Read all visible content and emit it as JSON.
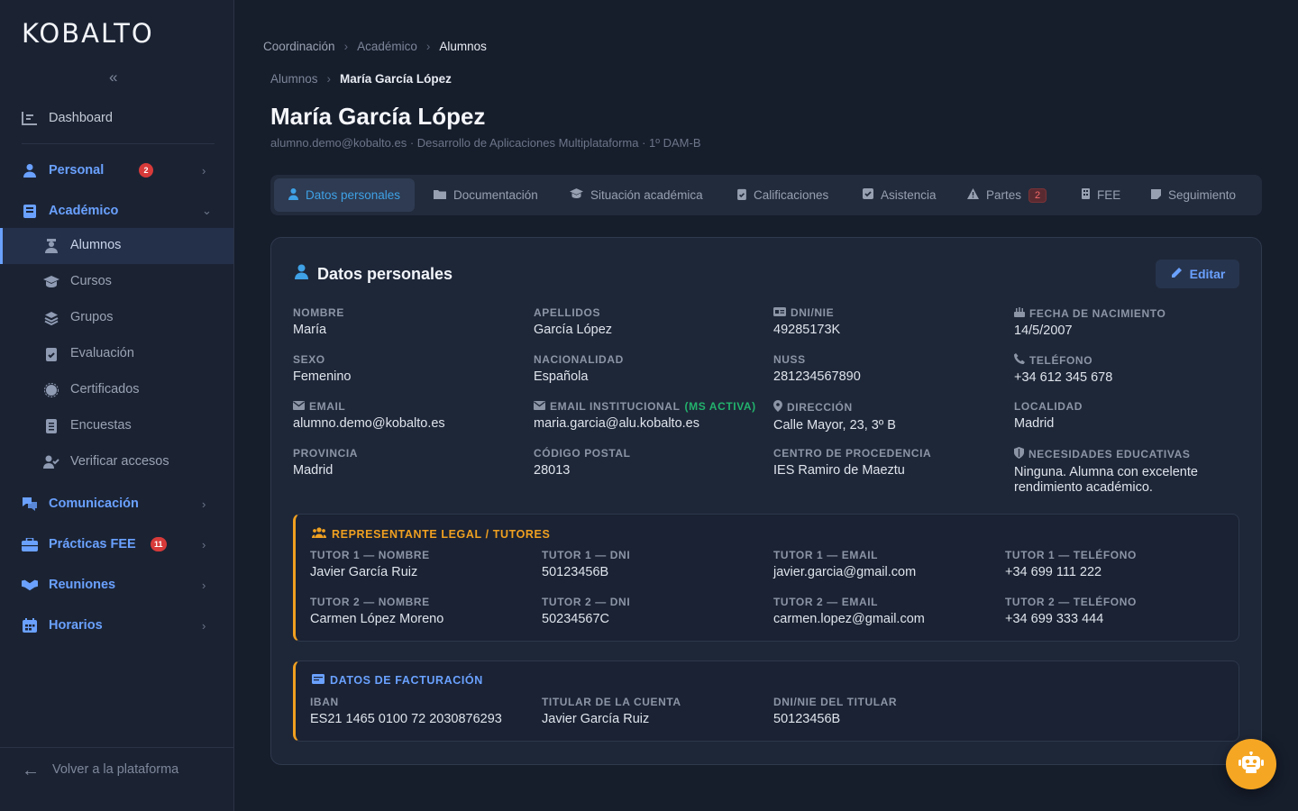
{
  "app": {
    "logo": "KOBALTO",
    "collapse_symbol": "«"
  },
  "sidebar": {
    "dashboard": "Dashboard",
    "groups": [
      {
        "label": "Personal",
        "badge": "2",
        "icon": "user-icon"
      },
      {
        "label": "Académico",
        "icon": "book-icon"
      },
      {
        "label": "Comunicación",
        "icon": "chat-icon"
      },
      {
        "label": "Prácticas FEE",
        "badge": "11",
        "icon": "briefcase-icon"
      },
      {
        "label": "Reuniones",
        "icon": "handshake-icon"
      },
      {
        "label": "Horarios",
        "icon": "calendar-icon"
      }
    ],
    "academic_items": [
      "Alumnos",
      "Cursos",
      "Grupos",
      "Evaluación",
      "Certificados",
      "Encuestas",
      "Verificar accesos"
    ],
    "back_label": "Volver a la plataforma"
  },
  "breadcrumb_top": [
    "Coordinación",
    "Académico",
    "Alumnos"
  ],
  "breadcrumb_page": [
    "Alumnos",
    "María García López"
  ],
  "page": {
    "title": "María García López",
    "subtitle": "alumno.demo@kobalto.es · Desarrollo de Aplicaciones Multiplataforma · 1º DAM-B"
  },
  "tabs": [
    {
      "label": "Datos personales"
    },
    {
      "label": "Documentación"
    },
    {
      "label": "Situación académica"
    },
    {
      "label": "Calificaciones"
    },
    {
      "label": "Asistencia"
    },
    {
      "label": "Partes",
      "badge": "2"
    },
    {
      "label": "FEE"
    },
    {
      "label": "Seguimiento"
    }
  ],
  "card": {
    "title": "Datos personales",
    "edit_label": "Editar",
    "fields": [
      {
        "label": "NOMBRE",
        "value": "María"
      },
      {
        "label": "APELLIDOS",
        "value": "García López"
      },
      {
        "label": "DNI/NIE",
        "value": "49285173K"
      },
      {
        "label": "FECHA DE NACIMIENTO",
        "value": "14/5/2007"
      },
      {
        "label": "SEXO",
        "value": "Femenino"
      },
      {
        "label": "NACIONALIDAD",
        "value": "Española"
      },
      {
        "label": "NUSS",
        "value": "281234567890"
      },
      {
        "label": "TELÉFONO",
        "value": "+34 612 345 678"
      },
      {
        "label": "EMAIL",
        "value": "alumno.demo@kobalto.es"
      },
      {
        "label": "EMAIL INSTITUCIONAL",
        "note": "(MS ACTIVA)",
        "value": "maria.garcia@alu.kobalto.es"
      },
      {
        "label": "DIRECCIÓN",
        "value": "Calle Mayor, 23, 3º B"
      },
      {
        "label": "LOCALIDAD",
        "value": "Madrid"
      },
      {
        "label": "PROVINCIA",
        "value": "Madrid"
      },
      {
        "label": "CÓDIGO POSTAL",
        "value": "28013"
      },
      {
        "label": "CENTRO DE PROCEDENCIA",
        "value": "IES Ramiro de Maeztu"
      },
      {
        "label": "NECESIDADES EDUCATIVAS",
        "value": "Ninguna. Alumna con excelente rendimiento académico."
      }
    ]
  },
  "tutors": {
    "title": "REPRESENTANTE LEGAL / TUTORES",
    "fields": [
      {
        "label": "TUTOR 1 — NOMBRE",
        "value": "Javier García Ruiz"
      },
      {
        "label": "TUTOR 1 — DNI",
        "value": "50123456B"
      },
      {
        "label": "TUTOR 1 — EMAIL",
        "value": "javier.garcia@gmail.com"
      },
      {
        "label": "TUTOR 1 — TELÉFONO",
        "value": "+34 699 111 222"
      },
      {
        "label": "TUTOR 2 — NOMBRE",
        "value": "Carmen López Moreno"
      },
      {
        "label": "TUTOR 2 — DNI",
        "value": "50234567C"
      },
      {
        "label": "TUTOR 2 — EMAIL",
        "value": "carmen.lopez@gmail.com"
      },
      {
        "label": "TUTOR 2 — TELÉFONO",
        "value": "+34 699 333 444"
      }
    ]
  },
  "billing": {
    "title": "DATOS DE FACTURACIÓN",
    "fields": [
      {
        "label": "IBAN",
        "value": "ES21 1465 0100 72 2030876293"
      },
      {
        "label": "TITULAR DE LA CUENTA",
        "value": "Javier García Ruiz"
      },
      {
        "label": "DNI/NIE DEL TITULAR",
        "value": "50123456B"
      }
    ]
  },
  "colors": {
    "accent": "#6aa1ff",
    "tab_active": "#3fa1e6",
    "warning": "#f0a020",
    "badge": "#d83a3a",
    "fab": "#f5a623"
  }
}
